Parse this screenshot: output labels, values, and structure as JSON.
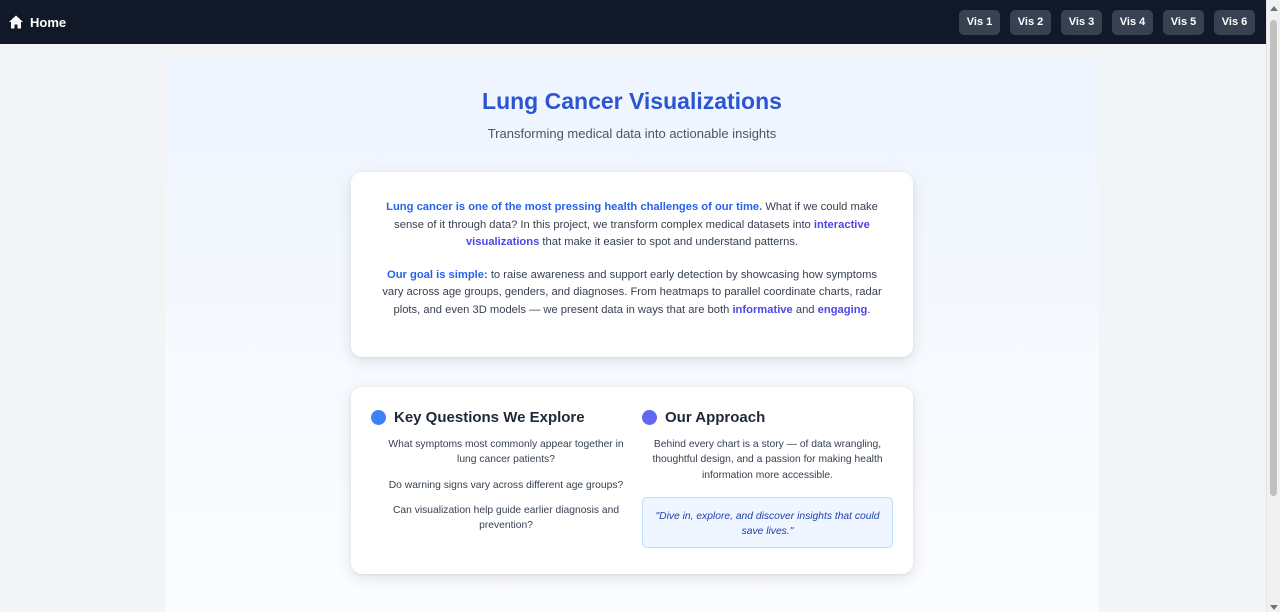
{
  "nav": {
    "home_label": "Home",
    "home_icon": "home-icon",
    "buttons": [
      {
        "label": "Vis 1"
      },
      {
        "label": "Vis 2"
      },
      {
        "label": "Vis 3"
      },
      {
        "label": "Vis 4"
      },
      {
        "label": "Vis 5"
      },
      {
        "label": "Vis 6"
      }
    ]
  },
  "header": {
    "title": "Lung Cancer Visualizations",
    "subtitle": "Transforming medical data into actionable insights"
  },
  "intro": {
    "p1_strong": "Lung cancer is one of the most pressing health challenges of our time.",
    "p1_text": " What if we could make sense of it through data? In this project, we transform complex medical datasets into ",
    "p1_highlight": "interactive visualizations",
    "p1_end": " that make it easier to spot and understand patterns.",
    "p2_strong": "Our goal is simple:",
    "p2_text": " to raise awareness and support early detection by showcasing how symptoms vary across age groups, genders, and diagnoses. From heatmaps to parallel coordinate charts, radar plots, and even 3D models — we present data in ways that are both ",
    "p2_hl1": "informative",
    "p2_and": " and ",
    "p2_hl2": "engaging",
    "p2_end": "."
  },
  "questions": {
    "title": "Key Questions We Explore",
    "items": [
      "What symptoms most commonly appear together in lung cancer patients?",
      "Do warning signs vary across different age groups?",
      "Can visualization help guide earlier diagnosis and prevention?"
    ]
  },
  "approach": {
    "title": "Our Approach",
    "text": "Behind every chart is a story — of data wrangling, thoughtful design, and a passion for making health information more accessible.",
    "quote": "\"Dive in, explore, and discover insights that could save lives.\""
  },
  "colors": {
    "navbar": "#111827",
    "nav_button": "#374151",
    "title_blue": "#2b55d4",
    "accent_blue": "#2563eb",
    "accent_purple": "#4f46e5",
    "dot_blue": "#3b82f6",
    "dot_purple": "#6366f1"
  }
}
